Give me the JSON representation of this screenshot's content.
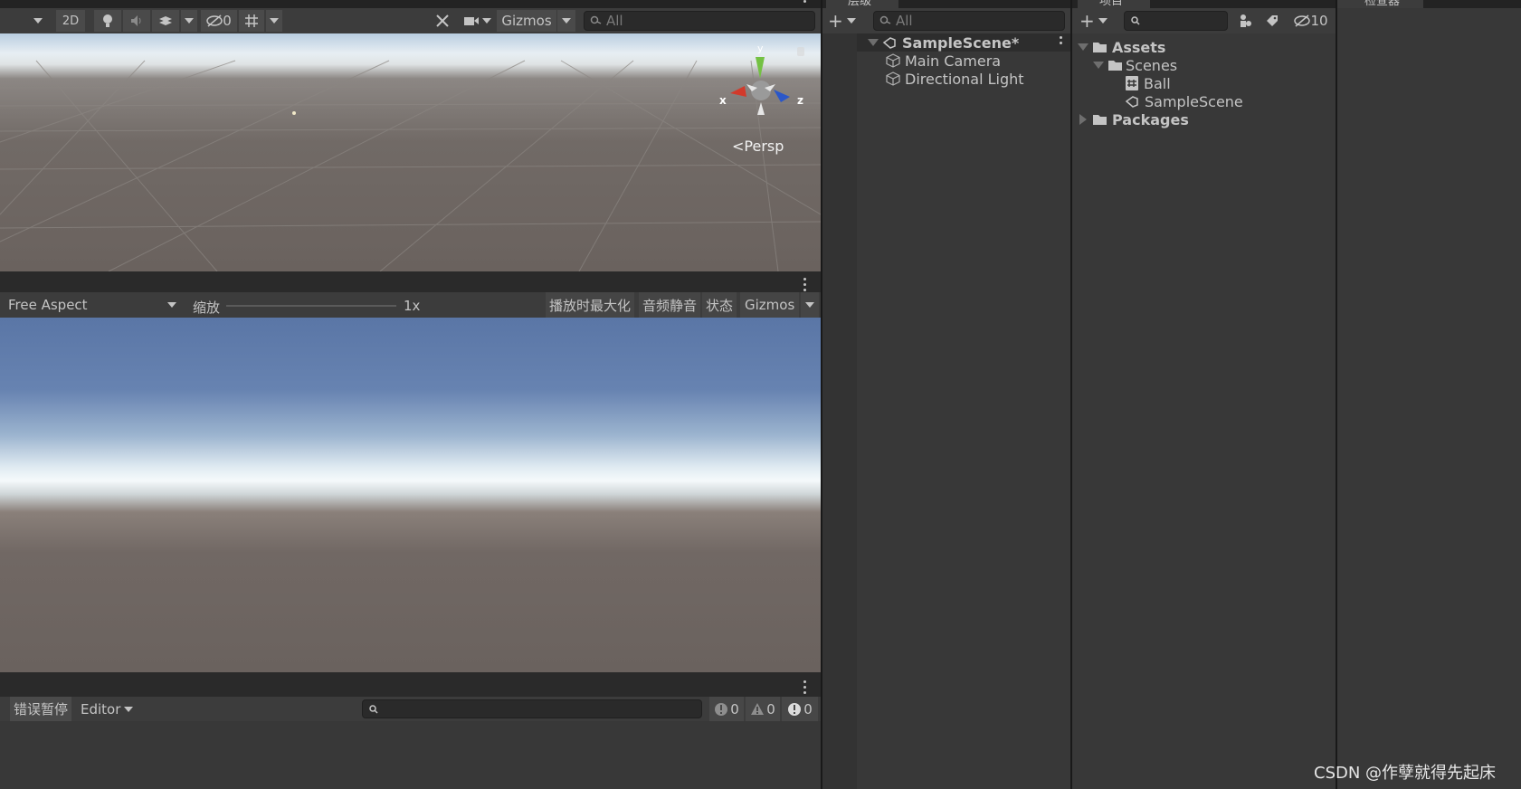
{
  "scene_toolbar": {
    "mode_2d": "2D",
    "hidden_count": "0",
    "gizmos_label": "Gizmos",
    "search_placeholder": "All",
    "persp_label": "Persp",
    "axis_x": "x",
    "axis_y": "y",
    "axis_z": "z"
  },
  "game_toolbar": {
    "aspect": "Free Aspect",
    "scale_label": "缩放",
    "scale_value": "1x",
    "maximize_label": "播放时最大化",
    "mute_label": "音频静音",
    "stats_label": "状态",
    "gizmos_label": "Gizmos"
  },
  "console": {
    "error_pause_label": "错误暂停",
    "editor_label": "Editor",
    "info_count": "0",
    "warning_count": "0",
    "error_count": "0"
  },
  "hierarchy": {
    "tab_label": "层级",
    "search_placeholder": "All",
    "scene_name": "SampleScene*",
    "items": [
      "Main Camera",
      "Directional Light"
    ]
  },
  "project": {
    "tab_label": "项目",
    "hidden_count": "10",
    "tree": {
      "assets": "Assets",
      "scenes": "Scenes",
      "ball": "Ball",
      "sample_scene": "SampleScene",
      "packages": "Packages"
    }
  },
  "inspector": {
    "tab_label": "检查器"
  },
  "watermark": "CSDN @作孽就得先起床",
  "colors": {
    "panel_bg": "#383838",
    "toolbar_bg": "#3c3c3c",
    "sky_top": "#5c7aa8",
    "horizon": "#eef4f8",
    "ground": "#6e645e"
  }
}
